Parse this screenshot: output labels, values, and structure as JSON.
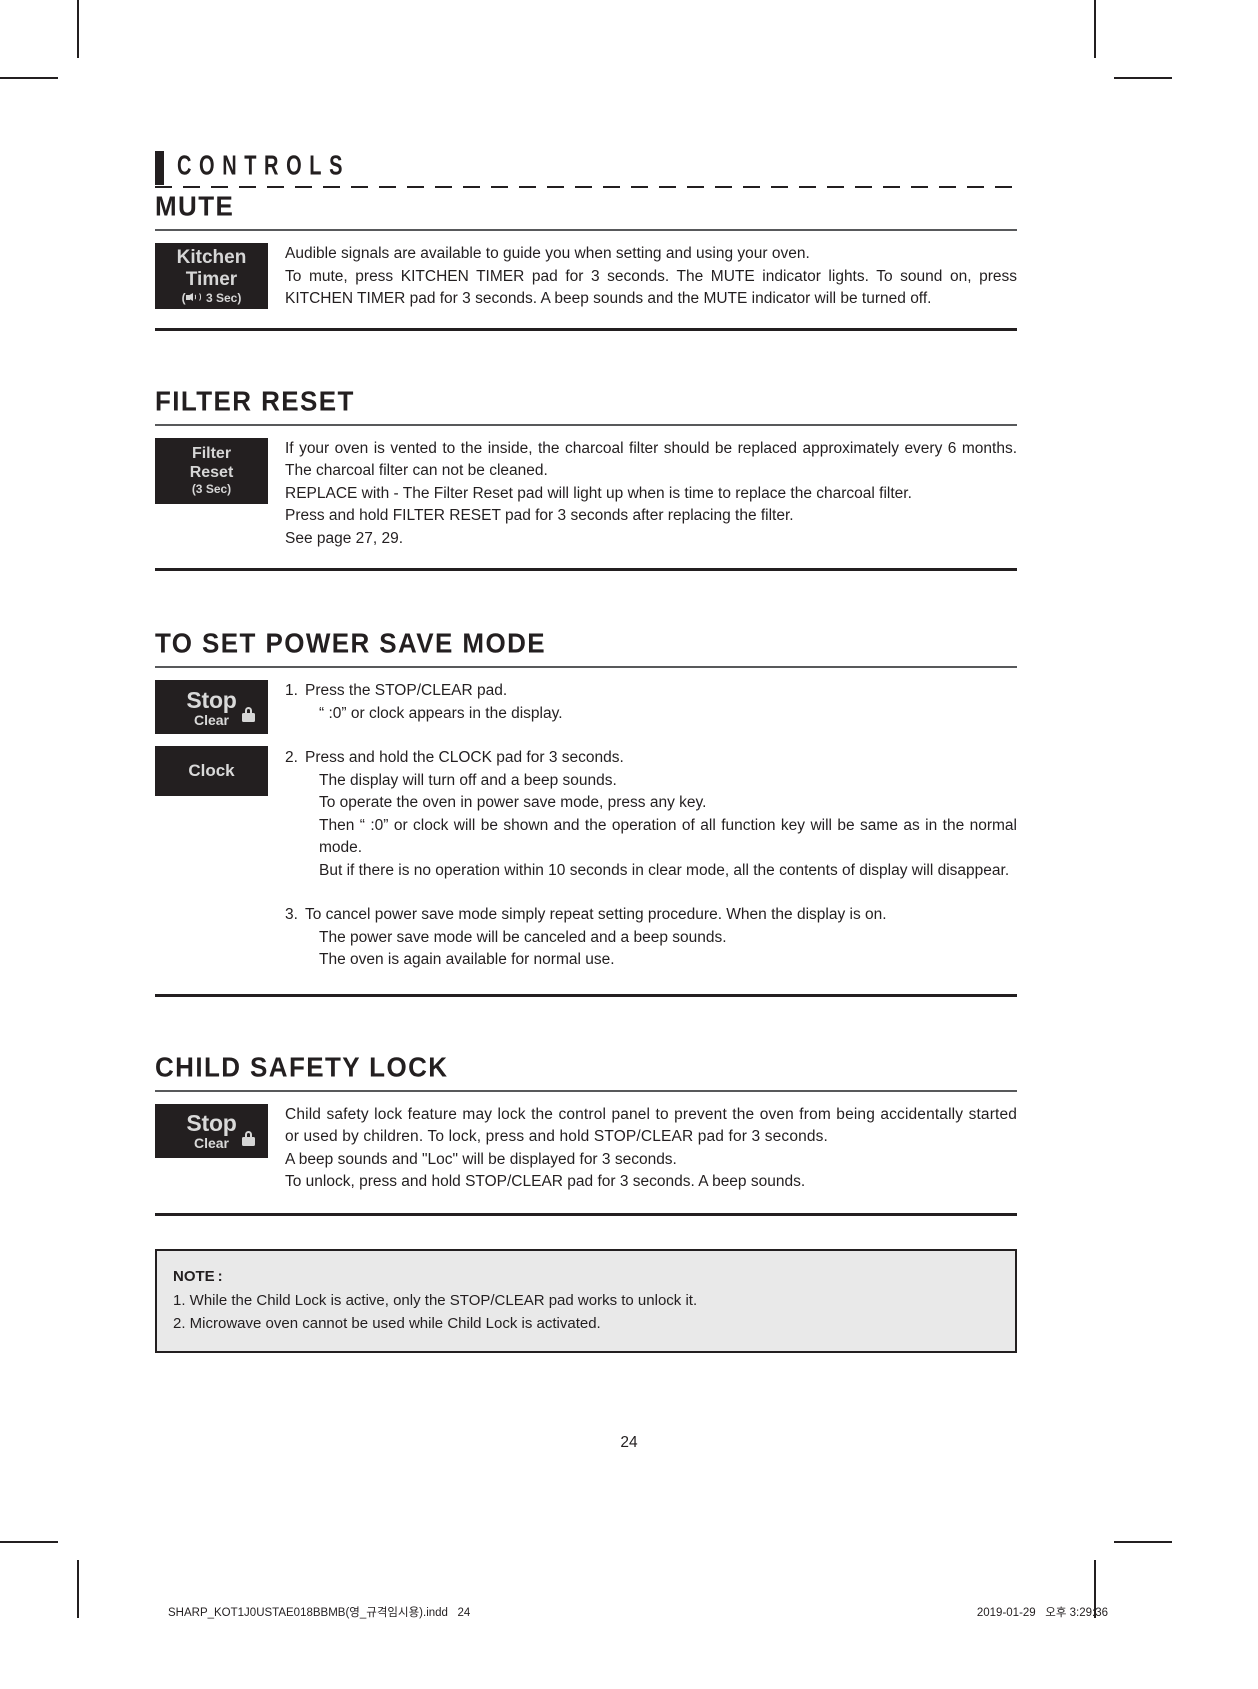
{
  "running_head": {
    "title": "CONTROLS"
  },
  "sections": [
    {
      "id": "mute",
      "heading": "MUTE",
      "pad": {
        "name": "kitchen-timer-pad",
        "line1": "Kitchen",
        "line2": "Timer",
        "line3_prefix": "(",
        "line3_suffix": "3 Sec)",
        "icon": "speaker-icon"
      },
      "paragraphs": [
        "Audible signals are available to guide you when setting and using your oven.",
        "To mute, press KITCHEN TIMER pad for 3 seconds. The MUTE indicator lights. To sound on, press KITCHEN TIMER pad for 3 seconds. A beep sounds and the MUTE indicator will be turned off."
      ]
    },
    {
      "id": "filter-reset",
      "heading": "FILTER RESET",
      "pad": {
        "name": "filter-reset-pad",
        "line1": "Filter",
        "line2": "Reset",
        "line3": "(3 Sec)"
      },
      "paragraphs": [
        "If your oven is vented to the inside, the charcoal filter should be replaced approximately every 6 months. The charcoal filter can not be cleaned.",
        "REPLACE with - The Filter Reset pad will light up when is time to replace the charcoal filter.",
        "Press and hold FILTER RESET pad for 3 seconds after replacing the filter.",
        "See page 27, 29."
      ]
    },
    {
      "id": "power-save",
      "heading": "TO SET POWER SAVE MODE",
      "pads": [
        {
          "name": "stop-clear-pad",
          "line1": "Stop",
          "line2": "Clear",
          "icon": "lock-icon"
        },
        {
          "name": "clock-pad",
          "line1": "Clock"
        }
      ],
      "steps": [
        {
          "num": "1.",
          "lines": [
            "Press the STOP/CLEAR pad.",
            "“ :0” or clock appears in the display."
          ]
        },
        {
          "num": "2.",
          "lines": [
            "Press and hold the CLOCK pad for 3 seconds.",
            "The display will turn off and a beep sounds.",
            "To operate the oven in power save mode, press any key.",
            "Then “ :0” or clock will be shown and the operation of all function key will be same as in the normal mode.",
            "But if there is no operation within 10 seconds in clear mode, all the contents of display will disappear."
          ]
        },
        {
          "num": "3.",
          "lines": [
            "To cancel power save mode simply repeat setting procedure. When the display is on.",
            "The power save mode will be canceled and a beep sounds.",
            "The oven is again available for normal use."
          ]
        }
      ]
    },
    {
      "id": "child-safety-lock",
      "heading": "CHILD SAFETY LOCK",
      "pad": {
        "name": "stop-clear-pad",
        "line1": "Stop",
        "line2": "Clear",
        "icon": "lock-icon"
      },
      "paragraphs": [
        "Child safety lock feature may lock the control panel to prevent the oven from being accidentally started or used by children. To lock, press and hold STOP/CLEAR pad for 3 seconds.",
        "A beep sounds and \"Loc\" will be displayed for 3 seconds.",
        "To unlock, press and hold STOP/CLEAR pad for 3 seconds. A beep sounds."
      ]
    }
  ],
  "note": {
    "title": "NOTE :",
    "items": [
      "1. While the Child Lock is active, only the STOP/CLEAR pad works to unlock it.",
      "2. Microwave oven cannot be used while Child Lock is activated."
    ]
  },
  "page_number": "24",
  "footer": {
    "left": "SHARP_KOT1J0USTAE018BBMB(영_규격임시용).indd   24",
    "right": "2019-01-29   오후 3:29:36"
  },
  "colors": {
    "ink": "#231f20",
    "pad_bg": "#231f20",
    "pad_text": "#d6d6d6",
    "rule_gray": "#58595b",
    "note_bg": "#e9e9e9"
  }
}
